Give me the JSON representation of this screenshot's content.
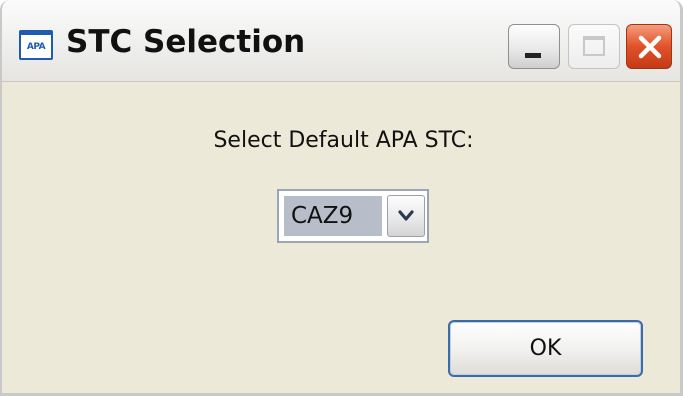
{
  "window": {
    "title": "STC Selection",
    "app_icon_text": "APA",
    "controls": {
      "minimize": "minimize-icon",
      "maximize": "maximize-icon",
      "close": "close-icon"
    }
  },
  "dialog": {
    "prompt": "Select Default APA STC:",
    "stc_select": {
      "selected_value": "CAZ9"
    },
    "ok_label": "OK"
  },
  "colors": {
    "close_button": "#e1522a",
    "default_button_border": "#3f6aa8",
    "selection_highlight": "#b7bec9"
  }
}
